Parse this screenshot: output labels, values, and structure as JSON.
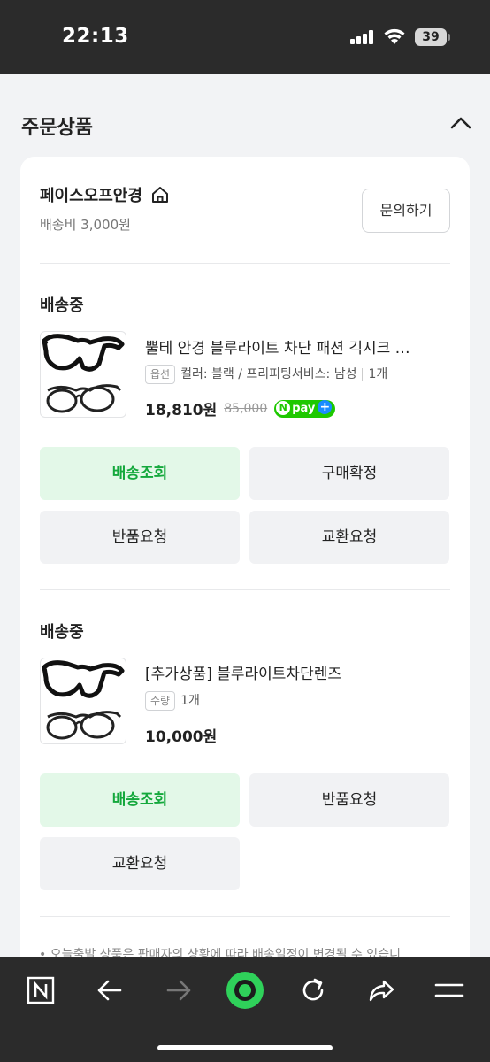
{
  "status_bar": {
    "time": "22:13",
    "battery": "39"
  },
  "section": {
    "title": "주문상품"
  },
  "seller": {
    "name": "페이스오프안경",
    "shipping_fee": "배송비 3,000원",
    "inquiry_label": "문의하기"
  },
  "orders": [
    {
      "status": "배송중",
      "product_name": "뿔테 안경 블루라이트 차단 패션 긱시크 …",
      "option_tag": "옵션",
      "option_text": "컬러: 블랙 / 프리피팅서비스: 남성",
      "quantity": "1개",
      "price": "18,810원",
      "original_price": "85,000",
      "npay_label": "pay",
      "npay_n": "N",
      "npay_plus": "+",
      "buttons": [
        "배송조회",
        "구매확정",
        "반품요청",
        "교환요청"
      ]
    },
    {
      "status": "배송중",
      "product_name": "[추가상품] 블루라이트차단렌즈",
      "option_tag": "수량",
      "quantity": "1개",
      "price": "10,000원",
      "buttons": [
        "배송조회",
        "반품요청",
        "교환요청"
      ]
    }
  ],
  "notice": "• 오늘출발 상품은 판매자의 상황에 따라 배송일정이 변경될 수 있습니",
  "toolbar": {
    "icons": [
      "naver-n-icon",
      "back-arrow-icon",
      "forward-arrow-icon",
      "green-dot-icon",
      "refresh-icon",
      "share-icon",
      "menu-icon"
    ],
    "n_label": "N"
  },
  "colors": {
    "accent_green": "#14a83c",
    "primary_btn_bg": "#e3f8e8",
    "npay_green": "#1ec800"
  }
}
